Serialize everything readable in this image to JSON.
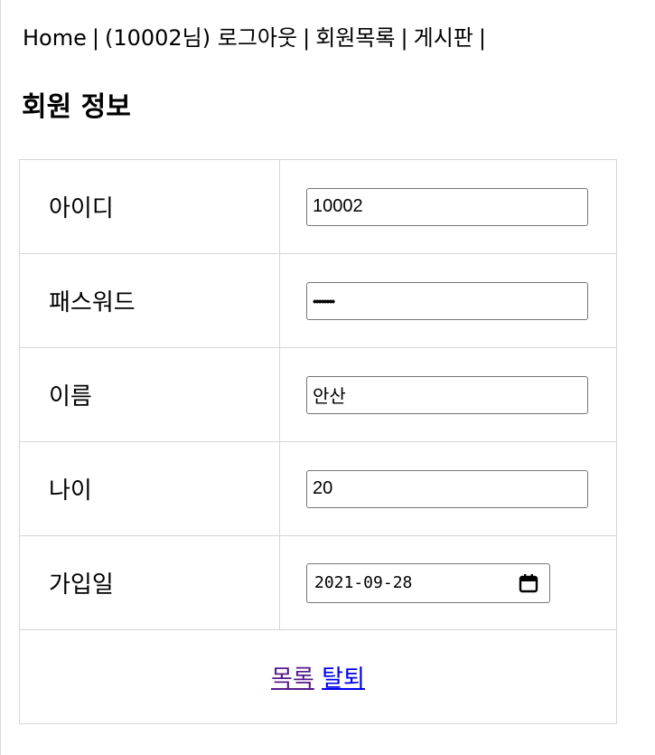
{
  "nav": {
    "home": "Home",
    "user": "(10002님)",
    "logout": "로그아웃",
    "members": "회원목록",
    "board": "게시판",
    "separator": "|"
  },
  "title": "회원 정보",
  "form": {
    "id_label": "아이디",
    "id_value": "10002",
    "password_label": "패스워드",
    "password_value": "••••••••",
    "name_label": "이름",
    "name_value": "안산",
    "age_label": "나이",
    "age_value": "20",
    "join_label": "가입일",
    "join_value": "2021-09-28"
  },
  "actions": {
    "list": "목록",
    "withdraw": "탈퇴"
  },
  "icons": {
    "calendar": "calendar-icon"
  },
  "colors": {
    "visited_link": "#551a8b",
    "link": "#0000ee",
    "border": "#d6d6d6"
  }
}
